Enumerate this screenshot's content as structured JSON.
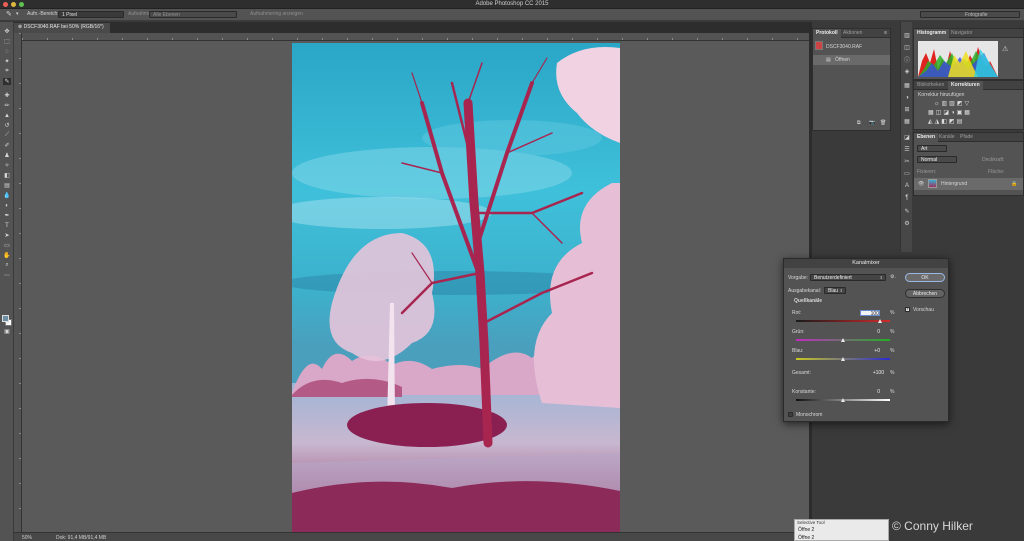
{
  "app": {
    "title": "Adobe Photoshop CC 2015"
  },
  "options_bar": {
    "sample_label": "Aufn.-Bereich:",
    "sample_value": "1 Pixel",
    "sample_layers_label": "Aufnahme:",
    "sample_layers_value": "Alle Ebenen",
    "show_ring": "Aufnahmering anzeigen",
    "workspace": "Fotografie"
  },
  "document": {
    "tab_label": "DSCF3040.RAF bei 50% (RGB/16*)",
    "zoom": "50%",
    "doc_size": "Dok: 91,4 MB/91,4 MB"
  },
  "history_panel": {
    "tabs": [
      "Protokoll",
      "Aktionen"
    ],
    "snapshot": "DSCF3040.RAF",
    "items": [
      "Öffnen"
    ]
  },
  "histogram_panel": {
    "tabs": [
      "Histogramm",
      "Navigator"
    ]
  },
  "adjustments_panel": {
    "tabs": [
      "Bibliotheken",
      "Korrekturen"
    ],
    "title": "Korrektur hinzufügen"
  },
  "layers_panel": {
    "tabs": [
      "Ebenen",
      "Kanäle",
      "Pfade"
    ],
    "kind": "Art",
    "blend_mode": "Normal",
    "opacity_label": "Deckkraft:",
    "lock_label": "Fixieren:",
    "fill_label": "Fläche:",
    "layers": [
      {
        "name": "Hintergrund"
      }
    ]
  },
  "dialog": {
    "title": "Kanalmixer",
    "preset_label": "Vorgabe:",
    "preset_value": "Benutzerdefiniert",
    "output_label": "Ausgabekanal:",
    "output_value": "Blau",
    "source_label": "Quellkanäle",
    "channels": [
      {
        "label": "Rot:",
        "value": "100",
        "unit": "%",
        "position": 0.9,
        "colors": [
          "#1a1a1a",
          "#d02a2a"
        ]
      },
      {
        "label": "Grün:",
        "value": "0",
        "unit": "%",
        "position": 0.5,
        "colors": [
          "#c22ac2",
          "#22b022"
        ]
      },
      {
        "label": "Blau:",
        "value": "+0",
        "unit": "%",
        "position": 0.5,
        "colors": [
          "#c8c822",
          "#2a2ad0"
        ]
      }
    ],
    "total_label": "Gesamt:",
    "total_value": "+100",
    "total_unit": "%",
    "constant_label": "Konstante:",
    "constant_value": "0",
    "constant_unit": "%",
    "constant_position": 0.5,
    "monochrome_label": "Monochrom",
    "ok_label": "OK",
    "cancel_label": "Abbrechen",
    "preview_label": "Vorschau",
    "preview_checked": true,
    "monochrome_checked": false
  },
  "float_panel": {
    "title": "Selective Tool",
    "rows": [
      "Öffne 2",
      "Öffne 2"
    ]
  },
  "watermark": "© Conny Hilker"
}
